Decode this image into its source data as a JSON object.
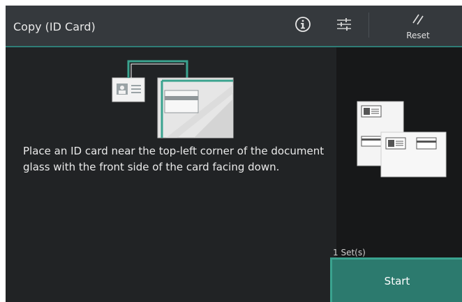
{
  "app": {
    "title": "Copy (ID Card)"
  },
  "header": {
    "info_icon": "info-icon",
    "settings_icon": "sliders-icon",
    "reset_label": "Reset",
    "reset_icon": "reset-slash-icon"
  },
  "main": {
    "instruction": "Place an ID card near the top-left corner of the document glass with the front side of the card facing down."
  },
  "side": {
    "sets_label": "1 Set(s)",
    "start_label": "Start"
  },
  "colors": {
    "accent": "#2f7d76",
    "start_button": "#2c7a6e",
    "background": "#1d1f21"
  }
}
